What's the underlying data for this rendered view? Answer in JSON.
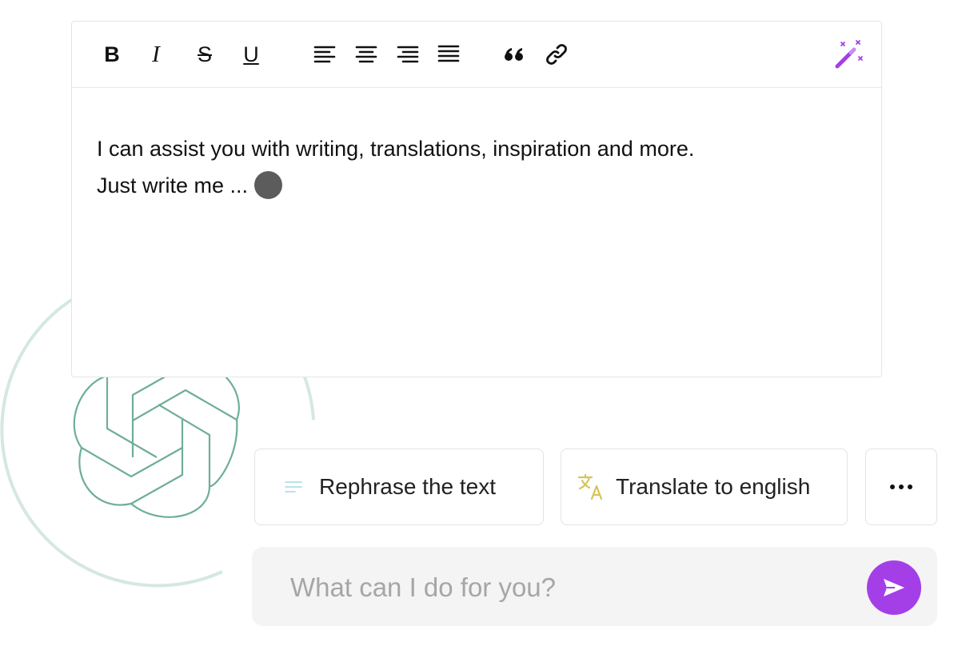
{
  "colors": {
    "accent": "#a43fe8",
    "logo_stroke": "#6fae95",
    "arc": "#d4e8e0",
    "translate_icon": "#d6c45a",
    "rephrase_icon": "#9fd9e6"
  },
  "toolbar": {
    "bold_label": "B",
    "italic_label": "I",
    "strike_label": "S",
    "underline_label": "U",
    "icons": [
      "bold-icon",
      "italic-icon",
      "strikethrough-icon",
      "underline-icon",
      "align-left-icon",
      "align-center-icon",
      "align-right-icon",
      "align-justify-icon",
      "quote-icon",
      "link-icon",
      "magic-wand-icon"
    ]
  },
  "editor": {
    "line1": "I can assist you with writing, translations, inspiration and more.",
    "line2": "Just write me ..."
  },
  "suggestions": {
    "rephrase": "Rephrase the text",
    "translate": "Translate to english",
    "more": "•••"
  },
  "prompt": {
    "placeholder": "What can I do for you?",
    "value": ""
  }
}
